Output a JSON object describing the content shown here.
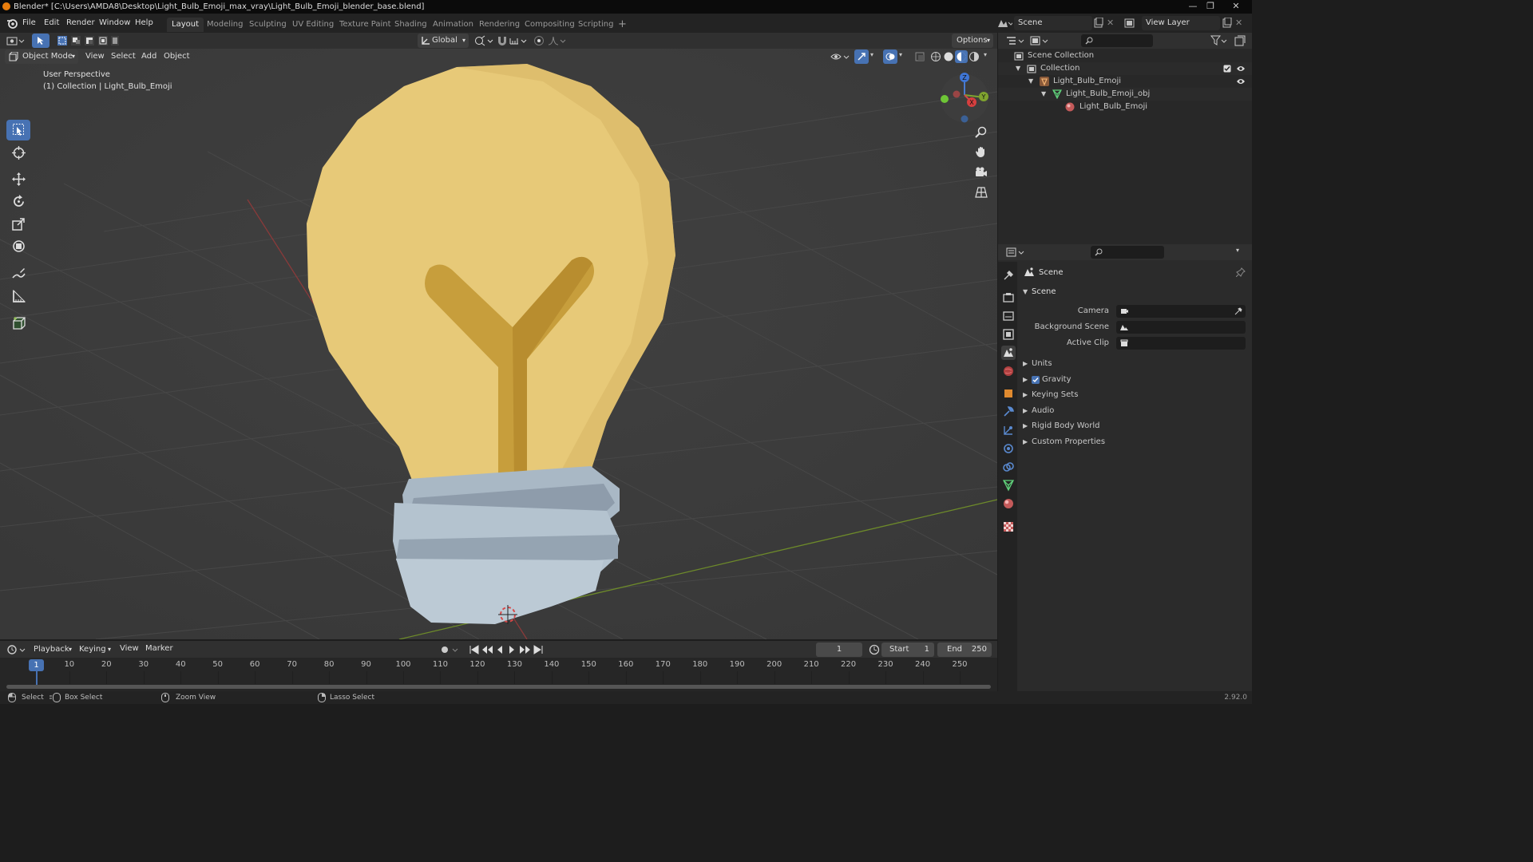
{
  "window": {
    "title": "Blender* [C:\\Users\\AMDA8\\Desktop\\Light_Bulb_Emoji_max_vray\\Light_Bulb_Emoji_blender_base.blend]",
    "minimize": "—",
    "maximize": "❐",
    "close": "✕"
  },
  "menubar": {
    "items": [
      "File",
      "Edit",
      "Render",
      "Window",
      "Help"
    ],
    "workspaces": [
      "Layout",
      "Modeling",
      "Sculpting",
      "UV Editing",
      "Texture Paint",
      "Shading",
      "Animation",
      "Rendering",
      "Compositing",
      "Scripting"
    ],
    "active_workspace": "Layout",
    "add_workspace": "+",
    "scene_name": "Scene",
    "view_layer": "View Layer"
  },
  "viewport_header": {
    "transform_orientation": "Global",
    "options_label": "Options",
    "mode": "Object Mode",
    "menus": [
      "View",
      "Select",
      "Add",
      "Object"
    ]
  },
  "viewport": {
    "perspective_label": "User Perspective",
    "collection_label": "(1) Collection | Light_Bulb_Emoji",
    "gizmo_axes": {
      "x": "X",
      "y": "Y",
      "z": "Z"
    },
    "colors": {
      "bulb": "#e7c978",
      "filament": "#c79e3c",
      "base": "#a9b8c5",
      "grid_x": "#8a3a3a",
      "grid_y": "#6d8a2a",
      "background": "#3d3d3d"
    }
  },
  "outliner": {
    "rows": [
      {
        "label": "Scene Collection",
        "level": 0
      },
      {
        "label": "Collection",
        "level": 1
      },
      {
        "label": "Light_Bulb_Emoji",
        "level": 2
      },
      {
        "label": "Light_Bulb_Emoji_obj",
        "level": 3
      },
      {
        "label": "Light_Bulb_Emoji",
        "level": 4
      }
    ]
  },
  "properties": {
    "context_label": "Scene",
    "panel_title": "Scene",
    "fields": [
      {
        "label": "Camera",
        "value": ""
      },
      {
        "label": "Background Scene",
        "value": ""
      },
      {
        "label": "Active Clip",
        "value": ""
      }
    ],
    "sections": [
      {
        "label": "Units",
        "checkbox": false
      },
      {
        "label": "Gravity",
        "checkbox": true
      },
      {
        "label": "Keying Sets",
        "checkbox": false
      },
      {
        "label": "Audio",
        "checkbox": false
      },
      {
        "label": "Rigid Body World",
        "checkbox": false
      },
      {
        "label": "Custom Properties",
        "checkbox": false
      }
    ]
  },
  "timeline": {
    "menus": [
      "Playback",
      "Keying",
      "View",
      "Marker"
    ],
    "current_frame": "1",
    "start_label": "Start",
    "start_value": "1",
    "end_label": "End",
    "end_value": "250",
    "ticks": [
      "1",
      "10",
      "20",
      "30",
      "40",
      "50",
      "60",
      "70",
      "80",
      "90",
      "100",
      "110",
      "120",
      "130",
      "140",
      "150",
      "160",
      "170",
      "180",
      "190",
      "200",
      "210",
      "220",
      "230",
      "240",
      "250"
    ]
  },
  "statusbar": {
    "select": "Select",
    "box_select": "Box Select",
    "zoom_view": "Zoom View",
    "lasso_select": "Lasso Select",
    "version": "2.92.0"
  }
}
